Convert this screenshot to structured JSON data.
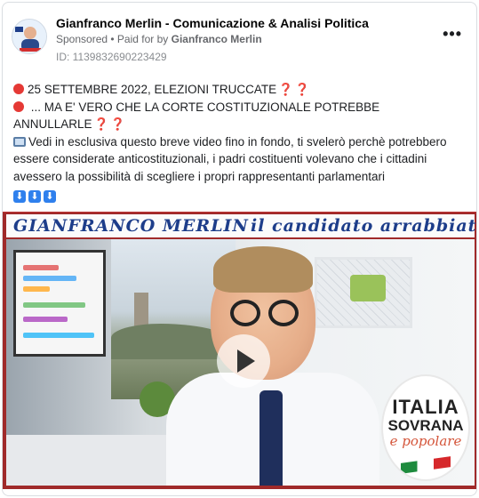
{
  "post": {
    "page_name": "Gianfranco Merlin - Comunicazione & Analisi Politica",
    "sponsored_label": "Sponsored",
    "paid_for_prefix": "• Paid for by ",
    "paid_for_name": "Gianfranco Merlin",
    "library_id": "ID: 1139832690223429",
    "more_label": "•••"
  },
  "body": {
    "line1": "25 SETTEMBRE 2022, ELEZIONI TRUCCATE",
    "line2": " ... MA E' VERO CHE LA CORTE COSTITUZIONALE POTREBBE",
    "line3": "ANNULLARLE",
    "qmark": "❓",
    "paragraph": "Vedi in esclusiva questo breve video fino in fondo, ti svelerò perchè potrebbero essere considerate anticostituzionali, i padri costituenti volevano che i cittadini avessero la possibilità di scegliere i propri rappresentanti parlamentari",
    "arrow": "⬇"
  },
  "media": {
    "banner_name": "GIANFRANCO MERLIN",
    "banner_tag": "il candidato arrabbiato",
    "logo_line1": "ITALIA",
    "logo_line2": "SOVRANA",
    "logo_line3": "e popolare"
  },
  "colors": {
    "banner_text": "#1d3d8a",
    "media_frame": "#a02a2a",
    "alert_red": "#e53935"
  }
}
